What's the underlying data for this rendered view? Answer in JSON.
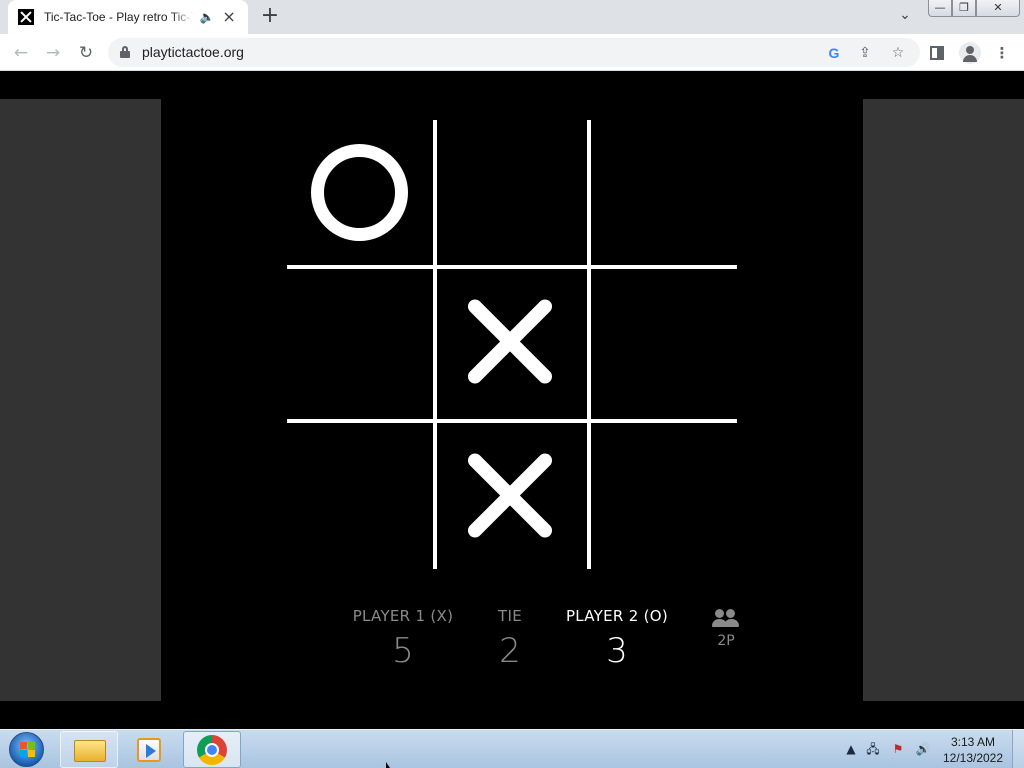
{
  "browser": {
    "tab": {
      "title": "Tic-Tac-Toe - Play retro Tic-Tac-Toe online for free"
    },
    "window_controls": {
      "minimize": "—",
      "restore": "❐",
      "close": "✕"
    },
    "address_bar": {
      "url": "playtictactoe.org"
    }
  },
  "game": {
    "board": [
      [
        "O",
        "",
        ""
      ],
      [
        "",
        "X",
        ""
      ],
      [
        "",
        "X",
        ""
      ]
    ],
    "scores": {
      "player1": {
        "label": "PLAYER 1 (X)",
        "value": "5"
      },
      "tie": {
        "label": "TIE",
        "value": "2"
      },
      "player2": {
        "label": "PLAYER 2 (O)",
        "value": "3"
      }
    },
    "mode": {
      "label": "2P",
      "icon": "two-players-icon"
    },
    "active_player": "player2",
    "colors": {
      "background": "#000000",
      "side_panels": "#333333",
      "foreground": "#ffffff",
      "inactive_text": "#8a8a8a"
    }
  },
  "taskbar": {
    "clock": {
      "time": "3:13 AM",
      "date": "12/13/2022"
    }
  }
}
